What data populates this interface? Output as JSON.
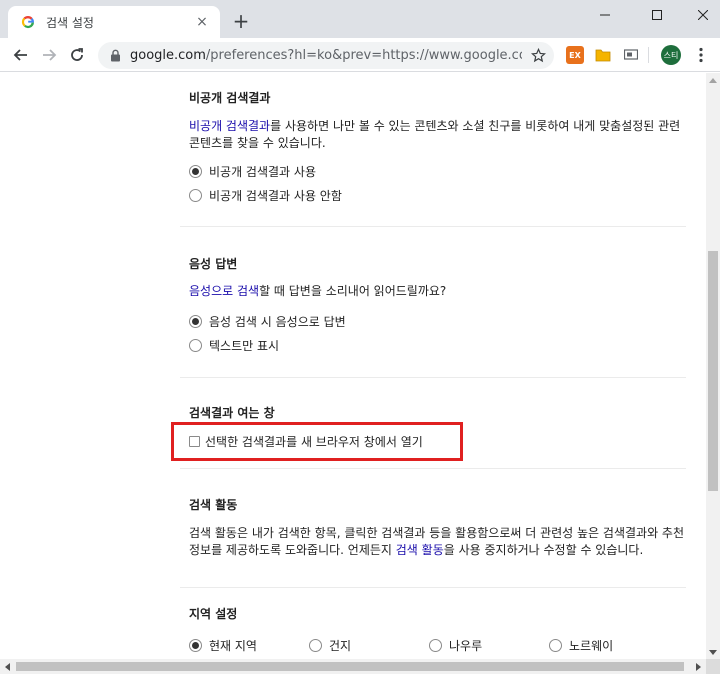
{
  "browser": {
    "tab_title": "검색 설정",
    "new_tab": "+",
    "tab_close": "×",
    "url_host": "google.com",
    "url_rest": "/preferences?hl=ko&prev=https://www.google.com/sea...",
    "ext_ex_label": "EX",
    "avatar_label": "스티"
  },
  "sections": {
    "private": {
      "title": "비공개 검색결과",
      "desc_link": "비공개 검색결과",
      "desc_text": "를 사용하면 나만 볼 수 있는 콘텐츠와 소셜 친구를 비롯하여 내게 맞춤설정된 관련 콘텐츠를 찾을 수 있습니다.",
      "options": [
        "비공개 검색결과 사용",
        "비공개 검색결과 사용 안함"
      ]
    },
    "voice": {
      "title": "음성 답변",
      "desc_link": "음성으로 검색",
      "desc_text": "할 때 답변을 소리내어 읽어드릴까요?",
      "options": [
        "음성 검색 시 음성으로 답변",
        "텍스트만 표시"
      ]
    },
    "window": {
      "title": "검색결과 여는 창",
      "checkbox_label": "선택한 검색결과를 새 브라우저 창에서 열기"
    },
    "activity": {
      "title": "검색 활동",
      "desc_before": "검색 활동은 내가 검색한 항목, 클릭한 검색결과 등을 활용함으로써 더 관련성 높은 검색결과와 추천 정보를 제공하도록 도와줍니다. 언제든지 ",
      "desc_link": "검색 활동",
      "desc_after": "을 사용 중지하거나 수정할 수 있습니다."
    },
    "region": {
      "title": "지역 설정",
      "options": [
        "현재 지역",
        "건지",
        "나우루",
        "노르웨이"
      ]
    }
  },
  "colors": {
    "link": "#1a0dab",
    "highlight": "#e02020",
    "avatar": "#1e6e3c",
    "ext_ex": "#e8711c"
  }
}
